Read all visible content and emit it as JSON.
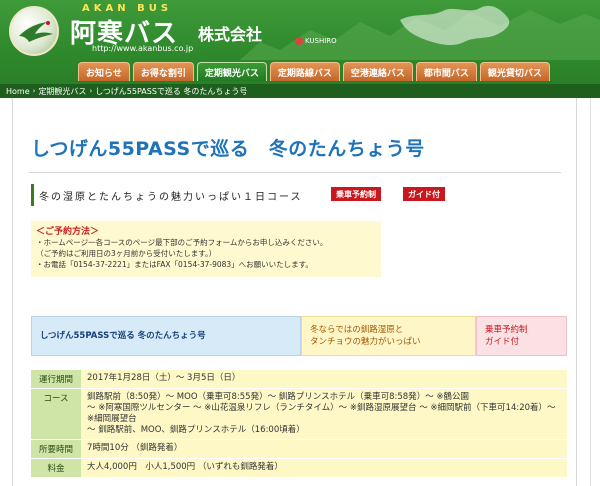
{
  "header": {
    "brand_en": "AKAN BUS",
    "brand_jp": "阿寒バス",
    "brand_suffix": "株式会社",
    "url": "http://www.akanbus.co.jp",
    "map_label": "KUSHIRO",
    "colors": {
      "header_green": "#2f8a2c",
      "tab_orange": "#d57a3c",
      "tab_active": "#2f8a2c",
      "breadcrumb": "#1f5f1e"
    }
  },
  "nav": {
    "tabs": [
      {
        "label": "お知らせ",
        "active": false
      },
      {
        "label": "お得な割引",
        "active": false
      },
      {
        "label": "定期観光バス",
        "active": true
      },
      {
        "label": "定期路線バス",
        "active": false
      },
      {
        "label": "空港連絡バス",
        "active": false
      },
      {
        "label": "都市間バス",
        "active": false
      },
      {
        "label": "観光貸切バス",
        "active": false
      }
    ]
  },
  "breadcrumb": [
    "Home",
    "定期観光バス",
    "しつげん55PASSで巡る 冬のたんちょう号"
  ],
  "page": {
    "title": "しつげん55PASSで巡る　冬のたんちょう号",
    "course_text": "冬の湿原とたんちょうの魅力いっぱい１日コース",
    "badges": [
      "乗車予約制",
      "ガイド付"
    ]
  },
  "notice": {
    "heading": "＜ご予約方法＞",
    "lines": [
      "・ホームページ一各コースのページ最下部のご予約フォームからお申し込みください。",
      "（ご予約はご利用日の3ヶ月前から受付いたします。）",
      "・お電話「0154-37-2221」またはFAX「0154-37-9083」へお願いいたします。"
    ]
  },
  "summary": {
    "name": "しつげん55PASSで巡る 冬のたんちょう号",
    "catch": [
      "冬ならではの釧路湿原と",
      "タンチョウの魅力がいっぱい"
    ],
    "features": [
      "乗車予約制",
      "ガイド付"
    ]
  },
  "details": {
    "rows": [
      {
        "label": "運行期間",
        "lines": [
          "2017年1月28日（土）～ 3月5日（日）"
        ]
      },
      {
        "label": "コース",
        "lines": [
          "釧路駅前（8:50発）～ MOO（乗車可8:55発）～ 釧路プリンスホテル（乗車可8:58発）～ ※鶴公園",
          "～ ※阿寒国際ツルセンター ～ ※山花温泉リフレ（ランチタイム）～ ※釧路湿原展望台 ～ ※細岡駅前（下車可14:20着）～ ※細岡展望台",
          "～ 釧路駅前、MOO、釧路プリンスホテル（16:00頃着）"
        ]
      },
      {
        "label": "所要時間",
        "lines": [
          "7時間10分 （釧路発着）"
        ]
      },
      {
        "label": "料金",
        "lines": [
          "大人4,000円　小人1,500円 （いずれも釧路発着）"
        ]
      }
    ]
  }
}
